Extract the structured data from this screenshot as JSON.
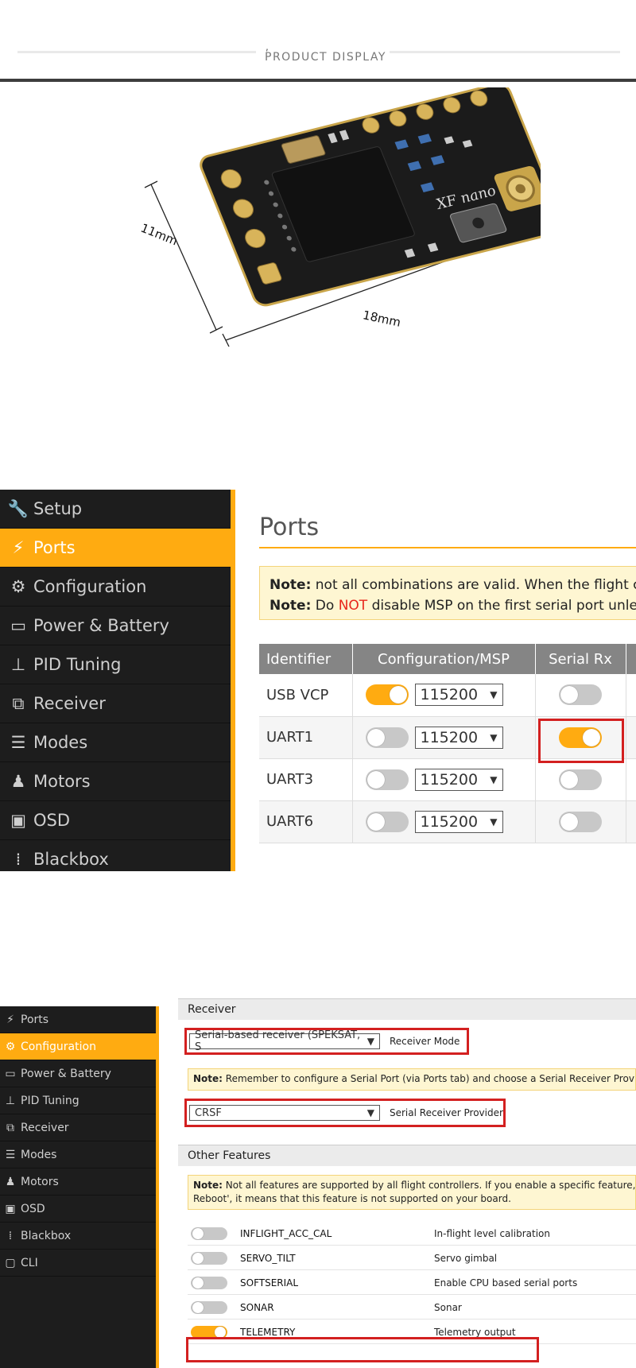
{
  "header": {
    "title": "PRODUCT DISPLAY"
  },
  "product": {
    "width_label": "11mm",
    "length_label": "18mm",
    "board_marking": "XF nano"
  },
  "ports_panel": {
    "sidebar": [
      {
        "label": "Setup",
        "icon": "wrench-icon",
        "active": false
      },
      {
        "label": "Ports",
        "icon": "plug-icon",
        "active": true
      },
      {
        "label": "Configuration",
        "icon": "gear-icon",
        "active": false
      },
      {
        "label": "Power & Battery",
        "icon": "battery-icon",
        "active": false
      },
      {
        "label": "PID Tuning",
        "icon": "pid-icon",
        "active": false
      },
      {
        "label": "Receiver",
        "icon": "receiver-icon",
        "active": false
      },
      {
        "label": "Modes",
        "icon": "modes-icon",
        "active": false
      },
      {
        "label": "Motors",
        "icon": "motor-icon",
        "active": false
      },
      {
        "label": "OSD",
        "icon": "osd-icon",
        "active": false
      },
      {
        "label": "Blackbox",
        "icon": "blackbox-icon",
        "active": false
      }
    ],
    "title": "Ports",
    "note1_label": "Note:",
    "note1_text": " not all combinations are valid. When the flight cor",
    "note2_label": "Note:",
    "note2_pre": " Do ",
    "note2_red": "NOT",
    "note2_post": " disable MSP on the first serial port unless",
    "columns": [
      "Identifier",
      "Configuration/MSP",
      "Serial Rx",
      ""
    ],
    "rows": [
      {
        "id": "USB VCP",
        "msp_on": true,
        "baud": "115200",
        "rx_on": false
      },
      {
        "id": "UART1",
        "msp_on": false,
        "baud": "115200",
        "rx_on": true
      },
      {
        "id": "UART3",
        "msp_on": false,
        "baud": "115200",
        "rx_on": false
      },
      {
        "id": "UART6",
        "msp_on": false,
        "baud": "115200",
        "rx_on": false
      }
    ]
  },
  "config_panel": {
    "sidebar": [
      {
        "label": "Ports",
        "icon": "plug-icon",
        "active": false
      },
      {
        "label": "Configuration",
        "icon": "gear-icon",
        "active": true
      },
      {
        "label": "Power & Battery",
        "icon": "battery-icon",
        "active": false
      },
      {
        "label": "PID Tuning",
        "icon": "pid-icon",
        "active": false
      },
      {
        "label": "Receiver",
        "icon": "receiver-icon",
        "active": false
      },
      {
        "label": "Modes",
        "icon": "modes-icon",
        "active": false
      },
      {
        "label": "Motors",
        "icon": "motor-icon",
        "active": false
      },
      {
        "label": "OSD",
        "icon": "osd-icon",
        "active": false
      },
      {
        "label": "Blackbox",
        "icon": "blackbox-icon",
        "active": false
      },
      {
        "label": "CLI",
        "icon": "cli-icon",
        "active": false
      }
    ],
    "receiver_header": "Receiver",
    "receiver_mode_value": "Serial-based receiver (SPEKSAT, S",
    "receiver_mode_label": "Receiver Mode",
    "receiver_note_label": "Note:",
    "receiver_note_text": " Remember to configure a Serial Port (via Ports tab) and choose a Serial Receiver Provider w",
    "provider_value": "CRSF",
    "provider_label": "Serial Receiver Provider",
    "features_header": "Other Features",
    "features_note_label": "Note:",
    "features_note_line1": " Not all features are supported by all flight controllers. If you enable a specific feature, and",
    "features_note_line2": "Reboot', it means that this feature is not supported on your board.",
    "features": [
      {
        "name": "INFLIGHT_ACC_CAL",
        "desc": "In-flight level calibration",
        "on": false
      },
      {
        "name": "SERVO_TILT",
        "desc": "Servo gimbal",
        "on": false
      },
      {
        "name": "SOFTSERIAL",
        "desc": "Enable CPU based serial ports",
        "on": false
      },
      {
        "name": "SONAR",
        "desc": "Sonar",
        "on": false
      },
      {
        "name": "TELEMETRY",
        "desc": "Telemetry output",
        "on": true
      }
    ]
  },
  "colors": {
    "accent": "#ffab11",
    "sidebar_bg": "#1d1d1d",
    "highlight_red": "#d32020"
  }
}
